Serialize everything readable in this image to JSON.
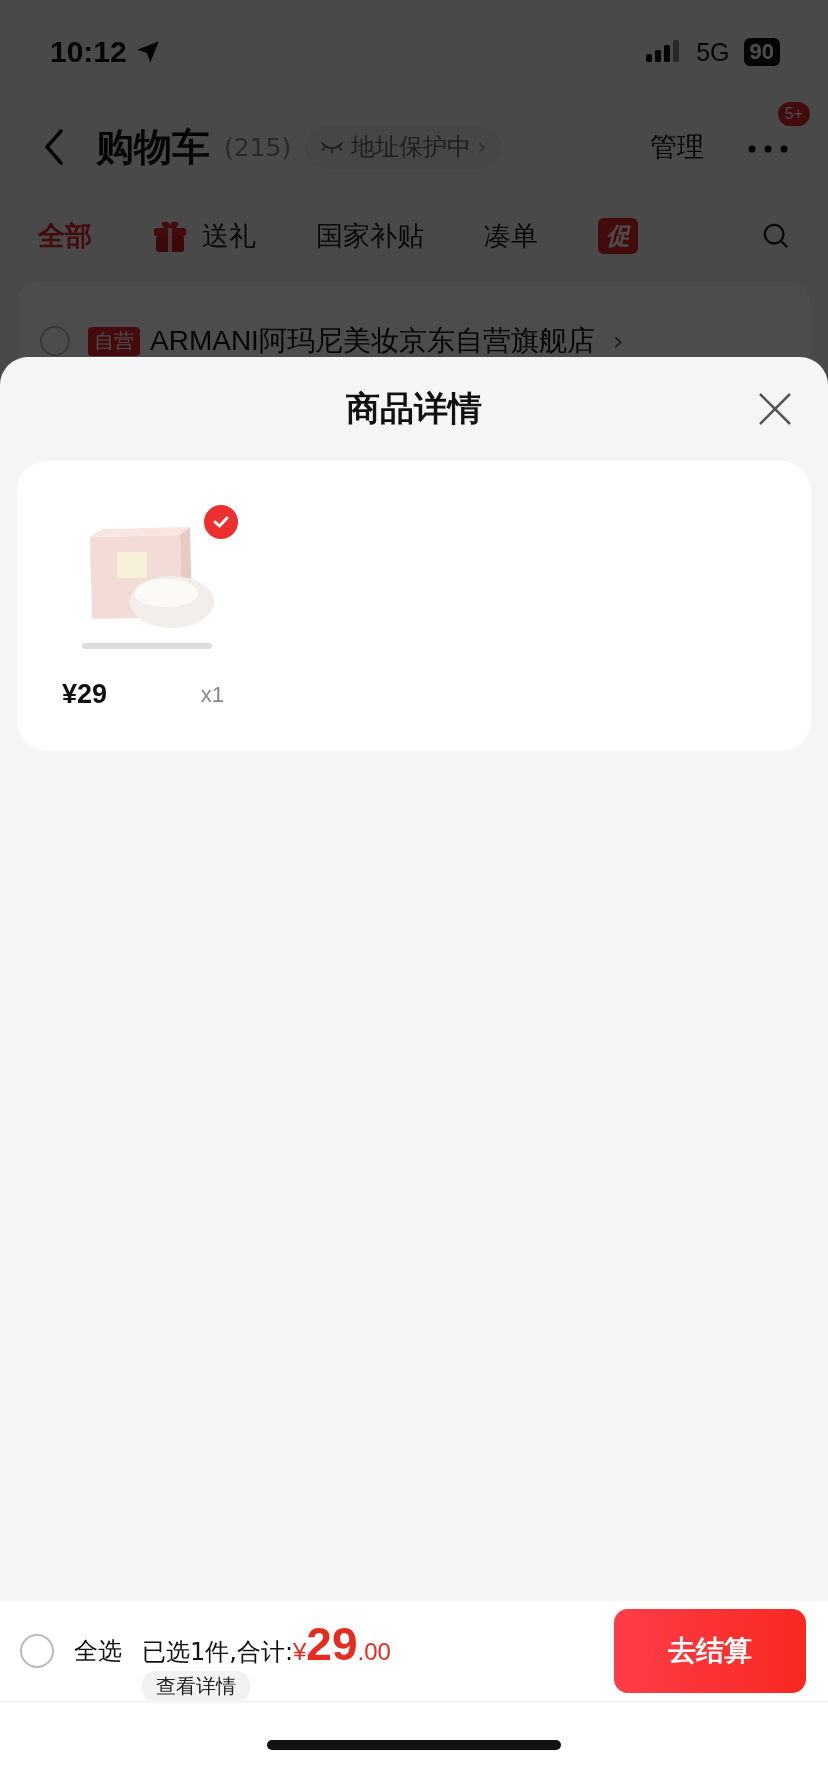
{
  "status_bar": {
    "time": "10:12",
    "network": "5G",
    "battery": "90"
  },
  "nav": {
    "title": "购物车",
    "count": "(215)",
    "address_badge": "地址保护中",
    "address_chevron": "›",
    "manage": "管理",
    "notification_badge": "5+"
  },
  "tabs": [
    {
      "label": "全部",
      "selected": true,
      "kind": "text"
    },
    {
      "label": "送礼",
      "selected": false,
      "kind": "gift"
    },
    {
      "label": "国家补贴",
      "selected": false,
      "kind": "text"
    },
    {
      "label": "凑单",
      "selected": false,
      "kind": "text"
    },
    {
      "label": "促",
      "selected": false,
      "kind": "tag"
    }
  ],
  "store": {
    "tag": "自营",
    "name": "ARMANI阿玛尼美妆京东自营旗舰店",
    "chevron": "›",
    "checked": false
  },
  "sheet": {
    "title": "商品详情",
    "items": [
      {
        "kind": "picture",
        "checked": true,
        "price": "¥29",
        "quantity": "x1"
      }
    ]
  },
  "footer": {
    "select_all": {
      "label": "全选",
      "checked": false
    },
    "summary": "已选1件,合计:",
    "currency": "¥",
    "amount_int": "29",
    "amount_dec": ".00",
    "details_link": "查看详情",
    "checkout": "去结算"
  }
}
